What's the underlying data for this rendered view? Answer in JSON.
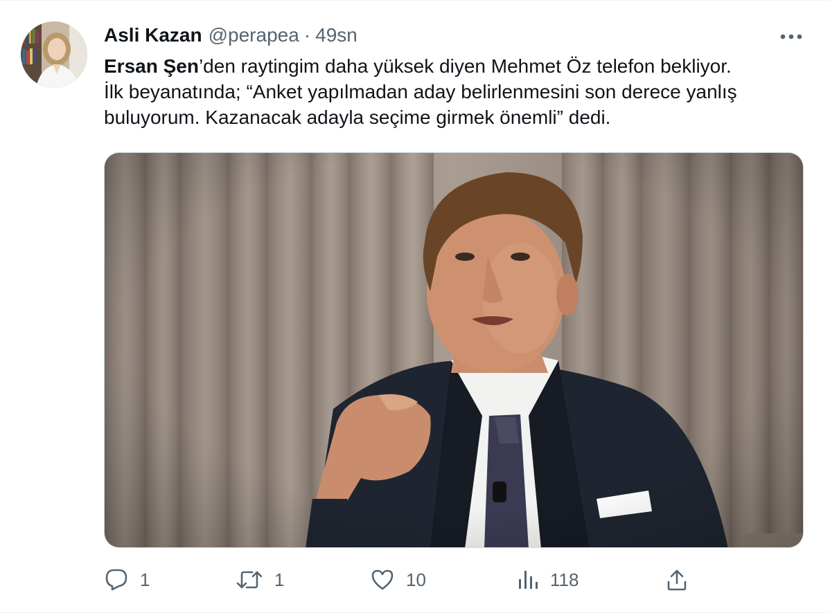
{
  "tweet": {
    "author": {
      "display_name": "Asli Kazan",
      "handle": "@perapea"
    },
    "separator": "·",
    "timestamp": "49sn",
    "text": {
      "mention_bold": "Ersan Şen",
      "line1_rest": "’den raytingim daha yüksek diyen Mehmet Öz telefon bekliyor.",
      "line2": "İlk beyanatında; “Anket yapılmadan aday belirlenmesini son derece yanlış",
      "line3": "buluyorum. Kazanacak adayla seçime girmek önemli” dedi."
    },
    "actions": {
      "reply_count": "1",
      "retweet_count": "1",
      "like_count": "10",
      "views_count": "118"
    },
    "icons": {
      "reply": "reply-icon",
      "retweet": "retweet-icon",
      "like": "heart-icon",
      "views": "views-icon",
      "share": "share-icon",
      "more": "more-icon"
    },
    "colors": {
      "text_primary": "#0f1419",
      "text_secondary": "#536471",
      "border": "#cfd9de"
    }
  }
}
